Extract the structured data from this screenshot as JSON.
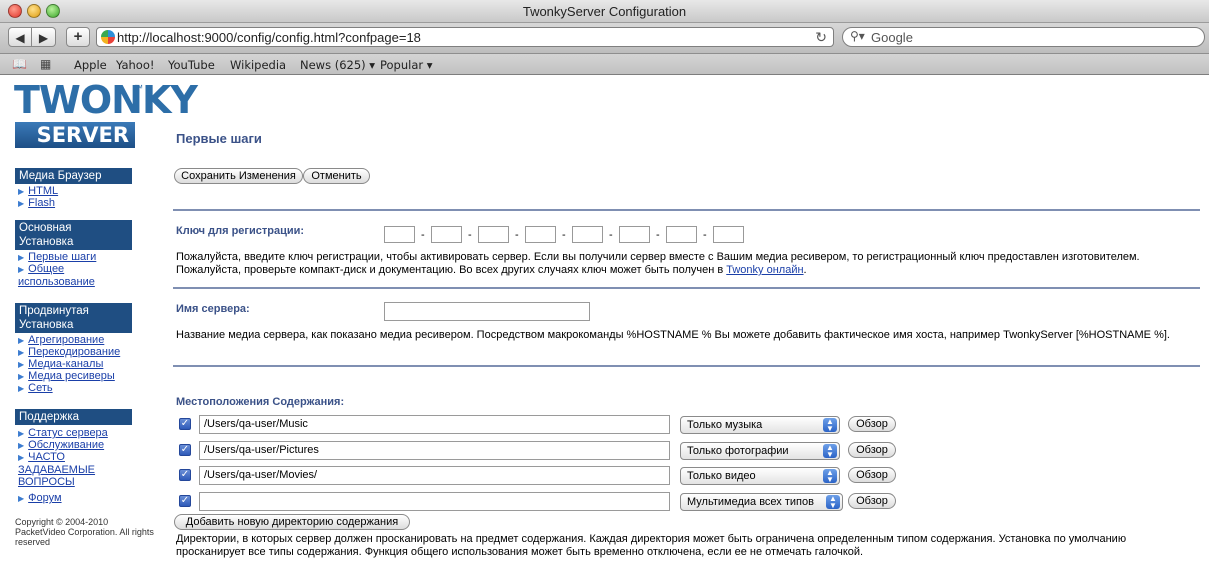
{
  "browser": {
    "window_title": "TwonkyServer Configuration",
    "nav_back": "◀",
    "nav_forward": "▶",
    "nav_add": "+",
    "url": "http://localhost:9000/config/config.html?confpage=18",
    "reload": "↻",
    "search_placeholder": "Google",
    "search_icon": "magnifier-icon",
    "bookmarks": [
      "Apple",
      "Yahoo!",
      "YouTube",
      "Wikipedia",
      "News (625) ▾",
      "Popular ▾"
    ]
  },
  "logo": {
    "top": "TWONKY",
    "tm": "™",
    "bottom": "SERVER"
  },
  "sidebar": {
    "groups": [
      {
        "heading": "Медиа Браузер",
        "items": [
          "HTML",
          "Flash"
        ]
      },
      {
        "heading": "Основная Установка",
        "items": [
          "Первые шаги",
          "Общее использование"
        ]
      },
      {
        "heading": "Продвинутая Установка",
        "items": [
          "Агрегирование",
          "Перекодирование",
          "Медиа-каналы",
          "Медиа ресиверы",
          "Сеть"
        ]
      },
      {
        "heading": "Поддержка",
        "items": [
          "Статус сервера",
          "Обслуживание",
          "ЧАСТО ЗАДАВАЕМЫЕ ВОПРОСЫ",
          "Форум"
        ]
      }
    ],
    "copyright": "Copyright © 2004-2010 PacketVideo Corporation. All rights reserved"
  },
  "main": {
    "title": "Первые шаги",
    "save_label": "Сохранить Изменения",
    "cancel_label": "Отменить",
    "registration": {
      "label": "Ключ для регистрации:",
      "help_1": "Пожалуйста, введите ключ регистрации, чтобы активировать сервер. Если вы получили сервер вместе с Вашим медиа ресивером, то регистрационный ключ предоставлен изготовителем.",
      "help_2": "Пожалуйста, проверьте компакт-диск и документацию. Во всех других случаях ключ может быть получен в",
      "link": "Twonky онлайн",
      "period": "."
    },
    "server_name": {
      "label": "Имя сервера:",
      "value": "",
      "help": "Название медиа сервера, как показано медиа ресивером. Посредством макрокоманды %HOSTNAME % Вы можете добавить фактическое имя хоста, например TwonkyServer [%HOSTNAME %]."
    },
    "content": {
      "label": "Местоположения Содержания:",
      "rows": [
        {
          "path": "/Users/qa-user/Music",
          "type": "Только музыка",
          "browse": "Обзор"
        },
        {
          "path": "/Users/qa-user/Pictures",
          "type": "Только фотографии",
          "browse": "Обзор"
        },
        {
          "path": "/Users/qa-user/Movies/",
          "type": "Только видео",
          "browse": "Обзор"
        },
        {
          "path": "",
          "type": "Мультимедиа всех типов",
          "browse": "Обзор"
        }
      ],
      "add_label": "Добавить новую директорию содержания",
      "help": "Директории, в которых сервер должен просканировать на предмет содержания. Каждая директория может быть ограничена определенным типом содержания. Установка по умолчанию просканирует все типы содержания. Функция общего использования может быть временно отключена, если ее не отмечать галочкой."
    }
  }
}
